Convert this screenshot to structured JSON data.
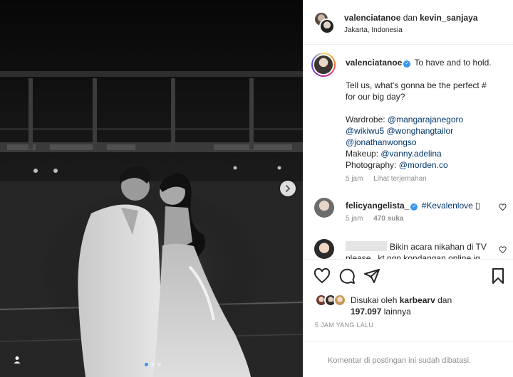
{
  "photo": {
    "alt_icon": "person-tag-icon",
    "next_icon": "chevron-right-icon",
    "carousel_count": 3,
    "carousel_active": 1
  },
  "header": {
    "user1": "valenciatanoe",
    "connector": "dan",
    "user2": "kevin_sanjaya",
    "location": "Jakarta, Indonesia"
  },
  "caption": {
    "username": "valenciatanoe",
    "line1": "To have and to hold.",
    "line2": "Tell us, what's gonna be the perfect #",
    "line3": "for our big day?",
    "wardrobe_label": "Wardrobe:",
    "wardrobe1": "@mangarajanegoro",
    "wardrobe2": "@wikiwu5",
    "wardrobe3": "@wonghangtailor",
    "wardrobe4": "@jonathanwongso",
    "makeup_label": "Makeup:",
    "makeup": "@vanny.adelina",
    "photo_label": "Photography:",
    "photo": "@morden.co",
    "time": "5 jam",
    "translate": "Lihat terjemahan"
  },
  "comments": [
    {
      "username": "felicyangelista_",
      "text": "#Kevalenlove",
      "emoji": "▯",
      "time": "5 jam",
      "likes": "470 suka"
    },
    {
      "username": "",
      "text": "Bikin acara nikahan di TV",
      "text2": "please.. kt ngn kondangan online jg"
    }
  ],
  "likes": {
    "prefix": "Disukai oleh",
    "user": "karbearv",
    "and": "dan",
    "count": "197.097",
    "others": "lainnya"
  },
  "timestamp": "5 JAM YANG LALU",
  "footer": {
    "message": "Komentar di postingan ini sudah dibatasi."
  }
}
